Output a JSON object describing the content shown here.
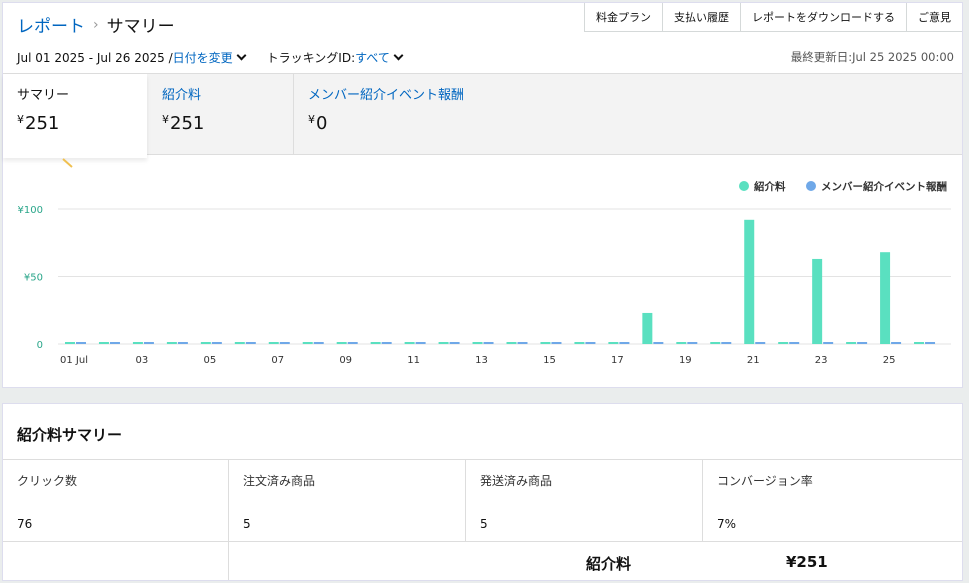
{
  "breadcrumb": {
    "parent": "レポート",
    "separator": "›",
    "current": "サマリー"
  },
  "top_buttons": [
    "料金プラン",
    "支払い履歴",
    "レポートをダウンロードする",
    "ご意見"
  ],
  "filters": {
    "date_range": "Jul 01 2025 - Jul 26 2025 /",
    "change_date": "日付を変更",
    "tracking_label": "トラッキングID:",
    "tracking_value": "すべて"
  },
  "last_updated": "最終更新日:Jul 25 2025 00:00",
  "tabs": [
    {
      "label": "サマリー",
      "currency": "¥",
      "value": "251",
      "active": true
    },
    {
      "label": "紹介料",
      "currency": "¥",
      "value": "251",
      "active": false
    },
    {
      "label": "メンバー紹介イベント報酬",
      "currency": "¥",
      "value": "0",
      "active": false
    }
  ],
  "colors": {
    "series1": "#5ae0c0",
    "series2": "#6fa8e8",
    "link": "#0066c0",
    "accent": "#f0c050"
  },
  "icons": {
    "chevron": "chevron-down-icon",
    "legend": "legend-dot-icon"
  },
  "chart_data": {
    "type": "bar",
    "categories": [
      "01 Jul",
      "02",
      "03",
      "04",
      "05",
      "06",
      "07",
      "08",
      "09",
      "10",
      "11",
      "12",
      "13",
      "14",
      "15",
      "16",
      "17",
      "18",
      "19",
      "20",
      "21",
      "22",
      "23",
      "24",
      "25",
      "26"
    ],
    "x_tick_labels": [
      "01 Jul",
      "03",
      "05",
      "07",
      "09",
      "11",
      "13",
      "15",
      "17",
      "19",
      "21",
      "23",
      "25"
    ],
    "y_ticks": [
      "¥100",
      "¥50",
      "0"
    ],
    "y_tick_values": [
      100,
      50,
      0
    ],
    "ylim": [
      0,
      100
    ],
    "grid": true,
    "legend_position": "top-right",
    "series": [
      {
        "name": "紹介料",
        "values": [
          0,
          0,
          0,
          0,
          0,
          0,
          0,
          0,
          0,
          0,
          0,
          0,
          0,
          0,
          0,
          0,
          0,
          23,
          0,
          0,
          92,
          0,
          63,
          0,
          68,
          0
        ]
      },
      {
        "name": "メンバー紹介イベント報酬",
        "values": [
          0,
          0,
          0,
          0,
          0,
          0,
          0,
          0,
          0,
          0,
          0,
          0,
          0,
          0,
          0,
          0,
          0,
          0,
          0,
          0,
          0,
          0,
          0,
          0,
          0,
          0
        ]
      }
    ]
  },
  "summary": {
    "title": "紹介料サマリー",
    "columns": [
      {
        "label": "クリック数",
        "value": "76"
      },
      {
        "label": "注文済み商品",
        "value": "5"
      },
      {
        "label": "発送済み商品",
        "value": "5"
      },
      {
        "label": "コンバージョン率",
        "value": "7%"
      }
    ],
    "total_label": "紹介料",
    "total_value": "¥251"
  }
}
